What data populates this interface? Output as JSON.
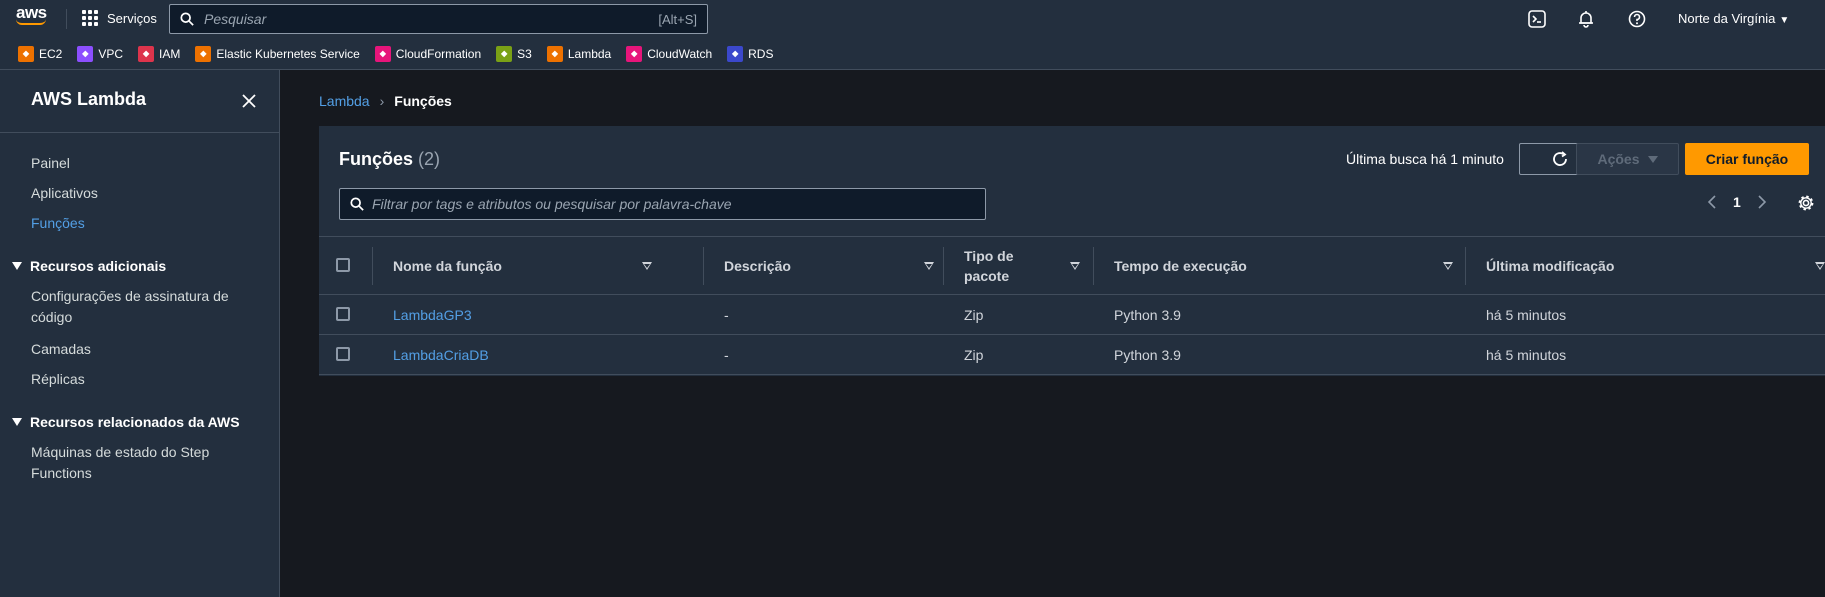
{
  "topbar": {
    "logo_text": "aws",
    "services_label": "Serviços",
    "search_placeholder": "Pesquisar",
    "search_shortcut": "[Alt+S]",
    "region": "Norte da Virgínia"
  },
  "favorites": [
    {
      "label": "EC2",
      "color": "#ed7100"
    },
    {
      "label": "VPC",
      "color": "#8c4fff"
    },
    {
      "label": "IAM",
      "color": "#dd344c"
    },
    {
      "label": "Elastic Kubernetes Service",
      "color": "#ed7100"
    },
    {
      "label": "CloudFormation",
      "color": "#e7157b"
    },
    {
      "label": "S3",
      "color": "#7aa116"
    },
    {
      "label": "Lambda",
      "color": "#ed7100"
    },
    {
      "label": "CloudWatch",
      "color": "#e7157b"
    },
    {
      "label": "RDS",
      "color": "#3b48cc"
    }
  ],
  "sidebar": {
    "title": "AWS Lambda",
    "items": [
      "Painel",
      "Aplicativos",
      "Funções"
    ],
    "section1_title": "Recursos adicionais",
    "section1_items": [
      "Configurações de assinatura de",
      "código",
      "Camadas",
      "Réplicas"
    ],
    "section2_title": "Recursos relacionados da AWS",
    "section2_items": [
      "Máquinas de estado do Step",
      "Functions"
    ]
  },
  "breadcrumb": {
    "root": "Lambda",
    "current": "Funções"
  },
  "panel": {
    "title": "Funções",
    "count": "(2)",
    "last_search": "Última busca há 1 minuto",
    "actions_label": "Ações",
    "create_label": "Criar função",
    "filter_placeholder": "Filtrar por tags e atributos ou pesquisar por palavra-chave",
    "page": "1"
  },
  "table": {
    "headers": [
      "Nome da função",
      "Descrição",
      "Tipo de",
      "pacote",
      "Tempo de execução",
      "Última modificação"
    ],
    "rows": [
      {
        "name": "LambdaGP3",
        "desc": "-",
        "pkg": "Zip",
        "runtime": "Python 3.9",
        "modified": "há 5 minutos"
      },
      {
        "name": "LambdaCriaDB",
        "desc": "-",
        "pkg": "Zip",
        "runtime": "Python 3.9",
        "modified": "há 5 minutos"
      }
    ]
  },
  "colors": {
    "accent": "#ff9900",
    "link": "#539fe5",
    "topbar": "#232f3e",
    "background": "#16191f"
  }
}
